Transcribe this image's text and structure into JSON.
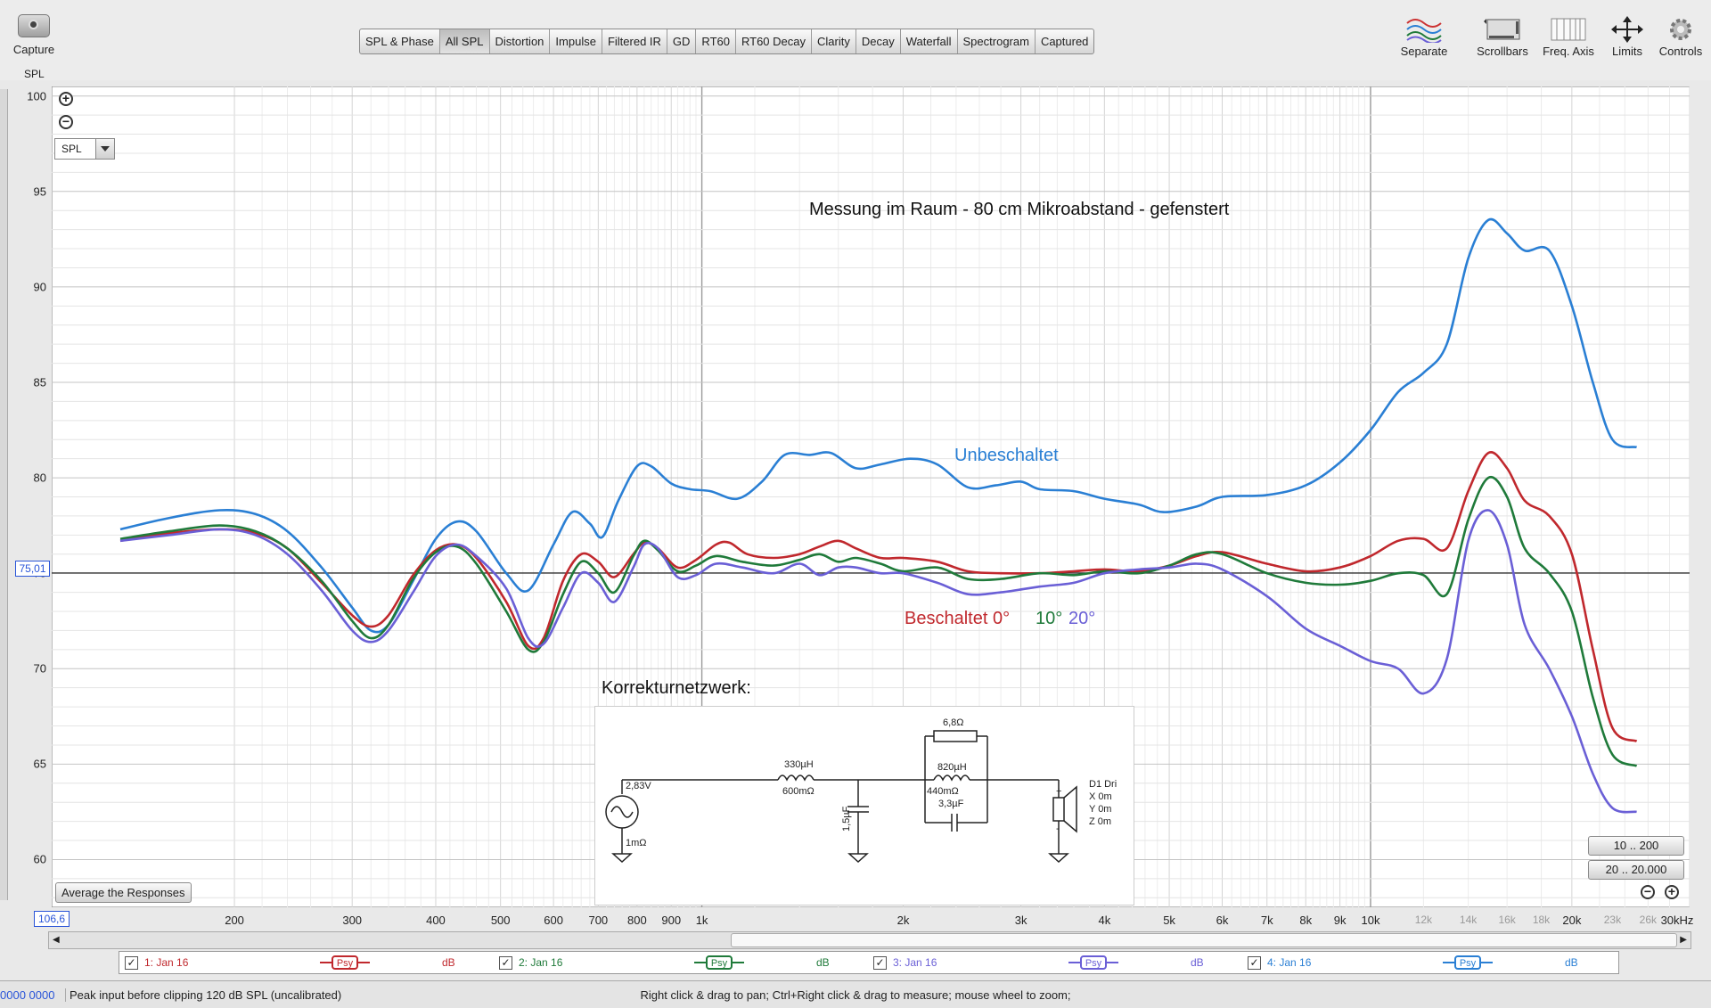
{
  "toolbar": {
    "capture_label": "Capture",
    "tabs": [
      "SPL & Phase",
      "All SPL",
      "Distortion",
      "Impulse",
      "Filtered IR",
      "GD",
      "RT60",
      "RT60 Decay",
      "Clarity",
      "Decay",
      "Waterfall",
      "Spectrogram",
      "Captured"
    ],
    "active_tab": "All SPL",
    "right_tools": [
      "Separate",
      "Scrollbars",
      "Freq. Axis",
      "Limits",
      "Controls"
    ]
  },
  "axis_label": "SPL",
  "spl_select_value": "SPL",
  "cursor_value": "75,01",
  "freq_start_value": "106,6",
  "average_button": "Average the Responses",
  "range_buttons": [
    "10 .. 200",
    "20 .. 20.000"
  ],
  "legend": [
    {
      "name": "1: Jan 16",
      "psy": "Psy",
      "unit": "dB",
      "color": "#c0282d"
    },
    {
      "name": "2: Jan 16",
      "psy": "Psy",
      "unit": "dB",
      "color": "#1f7a3a"
    },
    {
      "name": "3: Jan 16",
      "psy": "Psy",
      "unit": "dB",
      "color": "#6a5fd6"
    },
    {
      "name": "4: Jan 16",
      "psy": "Psy",
      "unit": "dB",
      "color": "#2a7fd4"
    }
  ],
  "status": {
    "left_value": "0000 0000",
    "peak": "Peak input before clipping 120 dB SPL (uncalibrated)",
    "hint": "Right click & drag to pan; Ctrl+Right click & drag to measure; mouse wheel to zoom;"
  },
  "annotations": {
    "title": "Messung im Raum - 80 cm Mikroabstand - gefenstert",
    "unbeschaltet": "Unbeschaltet",
    "beschaltet": "Beschaltet 0°",
    "ten": "10°",
    "twenty": "20°",
    "network": "Korrekturnetzwerk:"
  },
  "schematic": {
    "source_voltage": "2,83V",
    "source_res": "1mΩ",
    "l1": "330µH",
    "l1_res": "600mΩ",
    "c1": "1,5µF",
    "r_top": "6,8Ω",
    "l2": "820µH",
    "l2_res": "440mΩ",
    "c2": "3,3µF",
    "driver": [
      "D1 Dri",
      "X 0m",
      "Y 0m",
      "Z 0m"
    ]
  },
  "chart_data": {
    "type": "line",
    "xscale": "log",
    "xlim": [
      106.6,
      30000
    ],
    "ylim": [
      57.5,
      100.5
    ],
    "ylabel": "SPL",
    "y_ticks": [
      60,
      65,
      70,
      75,
      80,
      85,
      90,
      95,
      100
    ],
    "x_tick_labels": [
      {
        "f": 200,
        "label": "200",
        "major": true
      },
      {
        "f": 300,
        "label": "300",
        "major": true
      },
      {
        "f": 400,
        "label": "400",
        "major": true
      },
      {
        "f": 500,
        "label": "500",
        "major": true
      },
      {
        "f": 600,
        "label": "600",
        "major": true
      },
      {
        "f": 700,
        "label": "700",
        "major": true
      },
      {
        "f": 800,
        "label": "800",
        "major": true
      },
      {
        "f": 900,
        "label": "900",
        "major": true
      },
      {
        "f": 1000,
        "label": "1k",
        "major": true
      },
      {
        "f": 2000,
        "label": "2k",
        "major": true
      },
      {
        "f": 3000,
        "label": "3k",
        "major": true
      },
      {
        "f": 4000,
        "label": "4k",
        "major": true
      },
      {
        "f": 5000,
        "label": "5k",
        "major": true
      },
      {
        "f": 6000,
        "label": "6k",
        "major": true
      },
      {
        "f": 7000,
        "label": "7k",
        "major": true
      },
      {
        "f": 8000,
        "label": "8k",
        "major": true
      },
      {
        "f": 9000,
        "label": "9k",
        "major": true
      },
      {
        "f": 10000,
        "label": "10k",
        "major": true
      },
      {
        "f": 12000,
        "label": "12k",
        "major": false
      },
      {
        "f": 14000,
        "label": "14k",
        "major": false
      },
      {
        "f": 16000,
        "label": "16k",
        "major": false
      },
      {
        "f": 18000,
        "label": "18k",
        "major": false
      },
      {
        "f": 20000,
        "label": "20k",
        "major": true
      },
      {
        "f": 23000,
        "label": "23k",
        "major": false
      },
      {
        "f": 26000,
        "label": "26k",
        "major": false
      },
      {
        "f": 30000,
        "label": "30kHz",
        "major": true
      }
    ],
    "cursor_level": 75.01,
    "series": [
      {
        "name": "Unbeschaltet",
        "color": "#2a7fd4",
        "points": [
          [
            135,
            77.3
          ],
          [
            160,
            77.9
          ],
          [
            190,
            78.3
          ],
          [
            215,
            78.1
          ],
          [
            240,
            77.2
          ],
          [
            270,
            75.3
          ],
          [
            300,
            73.2
          ],
          [
            320,
            72.0
          ],
          [
            340,
            72.3
          ],
          [
            370,
            74.6
          ],
          [
            400,
            76.8
          ],
          [
            430,
            77.7
          ],
          [
            460,
            77.2
          ],
          [
            510,
            75.0
          ],
          [
            550,
            74.1
          ],
          [
            600,
            76.5
          ],
          [
            640,
            78.2
          ],
          [
            680,
            77.6
          ],
          [
            710,
            76.9
          ],
          [
            750,
            78.8
          ],
          [
            800,
            80.6
          ],
          [
            840,
            80.6
          ],
          [
            900,
            79.7
          ],
          [
            960,
            79.4
          ],
          [
            1030,
            79.3
          ],
          [
            1130,
            78.9
          ],
          [
            1230,
            79.8
          ],
          [
            1330,
            81.2
          ],
          [
            1450,
            81.2
          ],
          [
            1560,
            81.3
          ],
          [
            1700,
            80.5
          ],
          [
            1850,
            80.7
          ],
          [
            2050,
            81.0
          ],
          [
            2250,
            80.7
          ],
          [
            2500,
            79.5
          ],
          [
            2750,
            79.6
          ],
          [
            3000,
            79.8
          ],
          [
            3200,
            79.4
          ],
          [
            3600,
            79.3
          ],
          [
            4000,
            78.9
          ],
          [
            4500,
            78.6
          ],
          [
            4900,
            78.2
          ],
          [
            5500,
            78.5
          ],
          [
            6000,
            79.0
          ],
          [
            7000,
            79.1
          ],
          [
            8000,
            79.6
          ],
          [
            9000,
            80.8
          ],
          [
            10000,
            82.5
          ],
          [
            11000,
            84.5
          ],
          [
            12000,
            85.5
          ],
          [
            13000,
            87.0
          ],
          [
            14000,
            91.5
          ],
          [
            15000,
            93.5
          ],
          [
            16000,
            92.8
          ],
          [
            17000,
            91.9
          ],
          [
            18500,
            91.9
          ],
          [
            20000,
            89.0
          ],
          [
            21500,
            85.0
          ],
          [
            23000,
            82.0
          ],
          [
            25000,
            81.6
          ]
        ]
      },
      {
        "name": "Beschaltet 0°",
        "color": "#c0282d",
        "points": [
          [
            135,
            76.7
          ],
          [
            160,
            77.1
          ],
          [
            190,
            77.3
          ],
          [
            215,
            77.1
          ],
          [
            240,
            76.3
          ],
          [
            270,
            74.5
          ],
          [
            300,
            72.8
          ],
          [
            320,
            72.2
          ],
          [
            340,
            72.8
          ],
          [
            370,
            74.9
          ],
          [
            400,
            76.2
          ],
          [
            430,
            76.5
          ],
          [
            460,
            75.8
          ],
          [
            510,
            73.5
          ],
          [
            550,
            71.2
          ],
          [
            580,
            71.6
          ],
          [
            620,
            74.6
          ],
          [
            660,
            76.0
          ],
          [
            700,
            75.6
          ],
          [
            740,
            74.8
          ],
          [
            790,
            76.0
          ],
          [
            820,
            76.6
          ],
          [
            860,
            76.3
          ],
          [
            920,
            75.3
          ],
          [
            980,
            75.7
          ],
          [
            1050,
            76.5
          ],
          [
            1100,
            76.6
          ],
          [
            1170,
            76.0
          ],
          [
            1280,
            75.8
          ],
          [
            1400,
            76.0
          ],
          [
            1500,
            76.4
          ],
          [
            1600,
            76.7
          ],
          [
            1700,
            76.3
          ],
          [
            1850,
            75.8
          ],
          [
            2000,
            75.8
          ],
          [
            2250,
            75.6
          ],
          [
            2500,
            75.1
          ],
          [
            2800,
            75.0
          ],
          [
            3200,
            75.0
          ],
          [
            3600,
            75.1
          ],
          [
            4000,
            75.2
          ],
          [
            4500,
            75.1
          ],
          [
            5000,
            75.4
          ],
          [
            5500,
            75.9
          ],
          [
            6000,
            76.1
          ],
          [
            7000,
            75.5
          ],
          [
            8000,
            75.1
          ],
          [
            9000,
            75.3
          ],
          [
            10000,
            75.9
          ],
          [
            11000,
            76.7
          ],
          [
            12000,
            76.8
          ],
          [
            13000,
            76.3
          ],
          [
            14000,
            79.3
          ],
          [
            15000,
            81.3
          ],
          [
            16000,
            80.5
          ],
          [
            17000,
            78.8
          ],
          [
            18500,
            78.0
          ],
          [
            20000,
            76.0
          ],
          [
            21500,
            71.0
          ],
          [
            23000,
            66.9
          ],
          [
            25000,
            66.2
          ]
        ]
      },
      {
        "name": "10°",
        "color": "#1f7a3a",
        "points": [
          [
            135,
            76.8
          ],
          [
            160,
            77.2
          ],
          [
            190,
            77.5
          ],
          [
            215,
            77.2
          ],
          [
            240,
            76.3
          ],
          [
            270,
            74.6
          ],
          [
            300,
            72.5
          ],
          [
            320,
            71.6
          ],
          [
            340,
            72.3
          ],
          [
            370,
            74.7
          ],
          [
            400,
            76.1
          ],
          [
            430,
            76.4
          ],
          [
            460,
            75.5
          ],
          [
            510,
            73.0
          ],
          [
            550,
            71.0
          ],
          [
            580,
            71.4
          ],
          [
            620,
            73.9
          ],
          [
            660,
            75.6
          ],
          [
            700,
            75.0
          ],
          [
            740,
            74.0
          ],
          [
            790,
            75.9
          ],
          [
            820,
            76.7
          ],
          [
            860,
            76.2
          ],
          [
            920,
            75.1
          ],
          [
            980,
            75.4
          ],
          [
            1050,
            75.9
          ],
          [
            1150,
            75.6
          ],
          [
            1280,
            75.4
          ],
          [
            1400,
            75.7
          ],
          [
            1500,
            76.0
          ],
          [
            1600,
            75.6
          ],
          [
            1700,
            75.8
          ],
          [
            1850,
            75.5
          ],
          [
            2000,
            75.1
          ],
          [
            2250,
            75.3
          ],
          [
            2500,
            74.7
          ],
          [
            2800,
            74.7
          ],
          [
            3200,
            75.0
          ],
          [
            3600,
            74.9
          ],
          [
            4000,
            75.1
          ],
          [
            4500,
            75.0
          ],
          [
            5000,
            75.4
          ],
          [
            5500,
            76.0
          ],
          [
            6000,
            76.0
          ],
          [
            7000,
            75.0
          ],
          [
            8000,
            74.5
          ],
          [
            9000,
            74.4
          ],
          [
            10000,
            74.6
          ],
          [
            11000,
            75.0
          ],
          [
            12000,
            74.9
          ],
          [
            13000,
            73.9
          ],
          [
            14000,
            77.8
          ],
          [
            15000,
            80.0
          ],
          [
            16000,
            79.0
          ],
          [
            17000,
            76.3
          ],
          [
            18500,
            75.0
          ],
          [
            20000,
            73.0
          ],
          [
            21500,
            68.5
          ],
          [
            23000,
            65.5
          ],
          [
            25000,
            64.9
          ]
        ]
      },
      {
        "name": "20°",
        "color": "#6a5fd6",
        "points": [
          [
            135,
            76.7
          ],
          [
            160,
            77.0
          ],
          [
            190,
            77.3
          ],
          [
            215,
            77.0
          ],
          [
            240,
            76.0
          ],
          [
            270,
            74.1
          ],
          [
            300,
            72.0
          ],
          [
            320,
            71.4
          ],
          [
            340,
            72.0
          ],
          [
            370,
            74.0
          ],
          [
            400,
            75.9
          ],
          [
            430,
            76.5
          ],
          [
            460,
            75.9
          ],
          [
            510,
            74.2
          ],
          [
            550,
            71.6
          ],
          [
            580,
            71.3
          ],
          [
            620,
            73.2
          ],
          [
            660,
            75.0
          ],
          [
            700,
            74.5
          ],
          [
            740,
            73.5
          ],
          [
            790,
            75.3
          ],
          [
            820,
            76.5
          ],
          [
            860,
            76.3
          ],
          [
            920,
            74.8
          ],
          [
            980,
            74.9
          ],
          [
            1050,
            75.5
          ],
          [
            1150,
            75.3
          ],
          [
            1280,
            75.0
          ],
          [
            1400,
            75.5
          ],
          [
            1500,
            74.9
          ],
          [
            1600,
            75.3
          ],
          [
            1700,
            75.3
          ],
          [
            1850,
            75.0
          ],
          [
            2000,
            75.0
          ],
          [
            2250,
            74.5
          ],
          [
            2500,
            73.9
          ],
          [
            2800,
            74.0
          ],
          [
            3200,
            74.3
          ],
          [
            3600,
            74.5
          ],
          [
            4000,
            75.0
          ],
          [
            4500,
            75.2
          ],
          [
            5000,
            75.3
          ],
          [
            5500,
            75.5
          ],
          [
            6000,
            75.2
          ],
          [
            7000,
            73.8
          ],
          [
            8000,
            72.1
          ],
          [
            9000,
            71.2
          ],
          [
            10000,
            70.4
          ],
          [
            11000,
            70.0
          ],
          [
            12000,
            68.7
          ],
          [
            13000,
            70.5
          ],
          [
            14000,
            76.7
          ],
          [
            15000,
            78.3
          ],
          [
            16000,
            76.5
          ],
          [
            17000,
            72.3
          ],
          [
            18500,
            70.0
          ],
          [
            20000,
            67.5
          ],
          [
            21500,
            64.5
          ],
          [
            23000,
            62.7
          ],
          [
            25000,
            62.5
          ]
        ]
      }
    ]
  }
}
